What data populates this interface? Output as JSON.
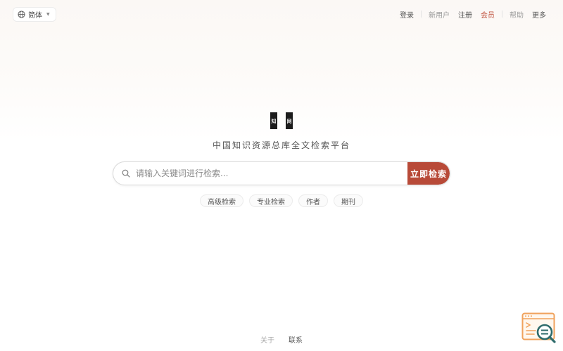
{
  "header": {
    "language": {
      "label": "简体",
      "icon": "globe-icon"
    },
    "nav": [
      {
        "label": "登录",
        "style": "normal"
      },
      {
        "label": "新用户",
        "style": "muted"
      },
      {
        "label": "注册",
        "style": "normal"
      },
      {
        "label": "会员",
        "style": "accent"
      },
      {
        "label": "帮助",
        "style": "muted"
      },
      {
        "label": "更多",
        "style": "normal"
      }
    ]
  },
  "hero": {
    "logo_left": "知",
    "logo_right": "网",
    "logo_text": "知网",
    "tagline": "中国知识资源总库全文检索平台",
    "search_placeholder": "请输入关键词进行检索...",
    "search_button": "立即检索",
    "search_icon": "magnifier-icon"
  },
  "chips": [
    "高级检索",
    "专业检索",
    "作者",
    "期刊"
  ],
  "footer": [
    {
      "label": "关于",
      "style": "muted"
    },
    {
      "label": "联系",
      "style": "normal"
    }
  ],
  "widget": {
    "icon": "search-window-icon"
  },
  "colors": {
    "accent": "#b84a38",
    "accent_text": "#c0523f",
    "widget_orange": "#f0a25c",
    "widget_teal": "#2e6b6b"
  }
}
